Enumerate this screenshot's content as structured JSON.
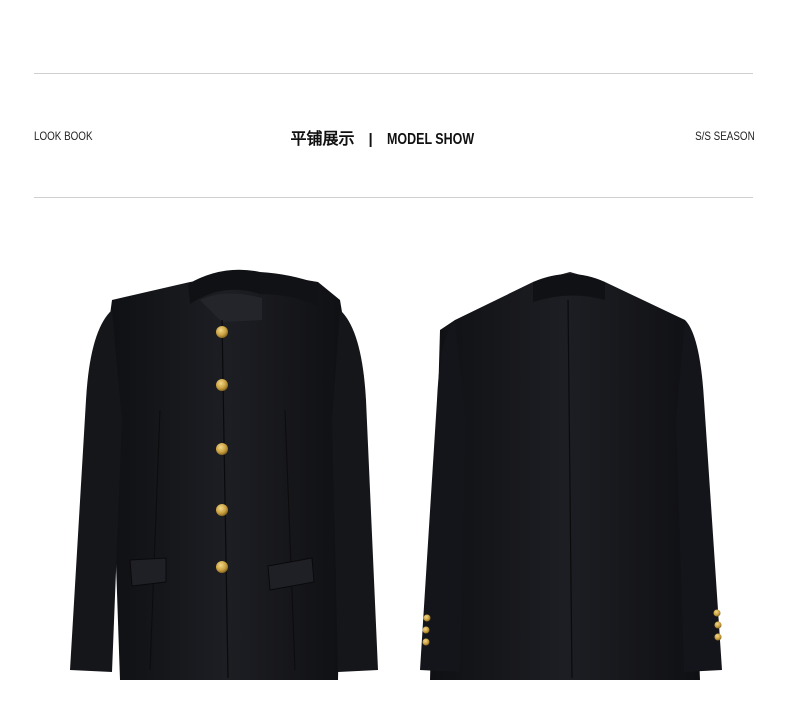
{
  "header": {
    "left_text": "LOOK BOOK",
    "center_cn": "平铺展示",
    "center_separator": "|",
    "center_en": "MODEL SHOW",
    "right_text": "S/S SEASON"
  },
  "products": [
    {
      "view": "front",
      "button_count": 5,
      "garment_color": "#17181c",
      "button_color": "#c9a040"
    },
    {
      "view": "back",
      "garment_color": "#17181c",
      "cuff_button_color": "#c9a040"
    }
  ]
}
